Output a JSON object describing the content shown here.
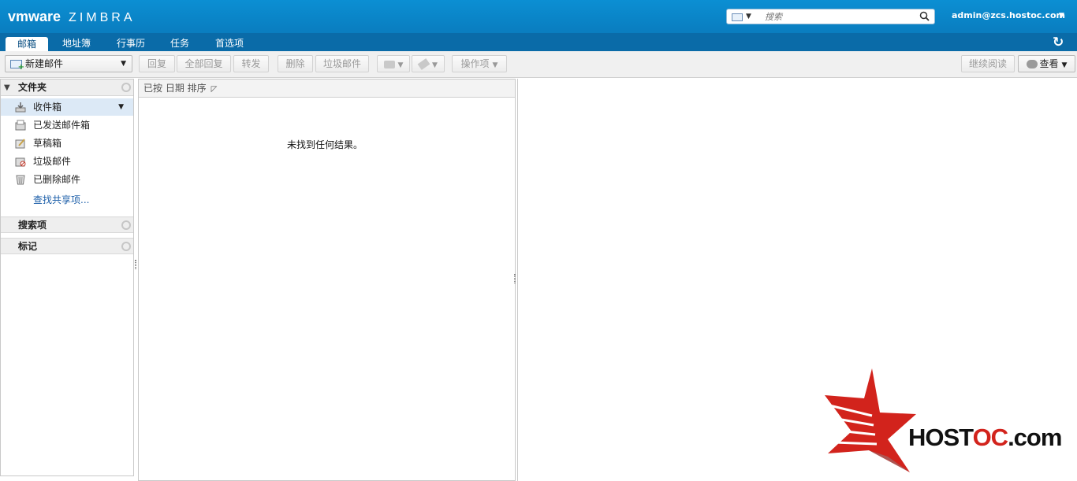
{
  "header": {
    "logo_vm": "vmware",
    "logo_zimbra": "ZIMBRA",
    "search_placeholder": "搜索",
    "user": "admin@zcs.hostoc.com"
  },
  "tabs": [
    {
      "label": "邮箱",
      "active": true
    },
    {
      "label": "地址簿",
      "active": false
    },
    {
      "label": "行事历",
      "active": false
    },
    {
      "label": "任务",
      "active": false
    },
    {
      "label": "首选项",
      "active": false
    }
  ],
  "toolbar": {
    "new_mail": "新建邮件",
    "reply": "回复",
    "reply_all": "全部回复",
    "forward": "转发",
    "delete": "删除",
    "spam": "垃圾邮件",
    "actions": "操作项",
    "continue_reading": "继续阅读",
    "view": "查看"
  },
  "sidebar": {
    "folders_title": "文件夹",
    "folders": [
      {
        "label": "收件箱",
        "icon": "inbox-icon",
        "selected": true
      },
      {
        "label": "已发送邮件箱",
        "icon": "sent-icon",
        "selected": false
      },
      {
        "label": "草稿箱",
        "icon": "drafts-icon",
        "selected": false
      },
      {
        "label": "垃圾邮件",
        "icon": "junk-icon",
        "selected": false
      },
      {
        "label": "已删除邮件",
        "icon": "trash-icon",
        "selected": false
      }
    ],
    "find_shares": "查找共享项...",
    "searches_title": "搜索项",
    "tags_title": "标记"
  },
  "list": {
    "sort_label": "已按 日期 排序",
    "empty_message": "未找到任何结果。"
  },
  "watermark": {
    "brand_a": "HOST",
    "brand_b": "OC",
    "brand_c": ".com"
  },
  "colors": {
    "banner": "#0b8fd3",
    "tabbar": "#0a6ba8",
    "selected_folder": "#dce9f6",
    "link": "#1a5da8",
    "brand_red": "#d2231c"
  }
}
